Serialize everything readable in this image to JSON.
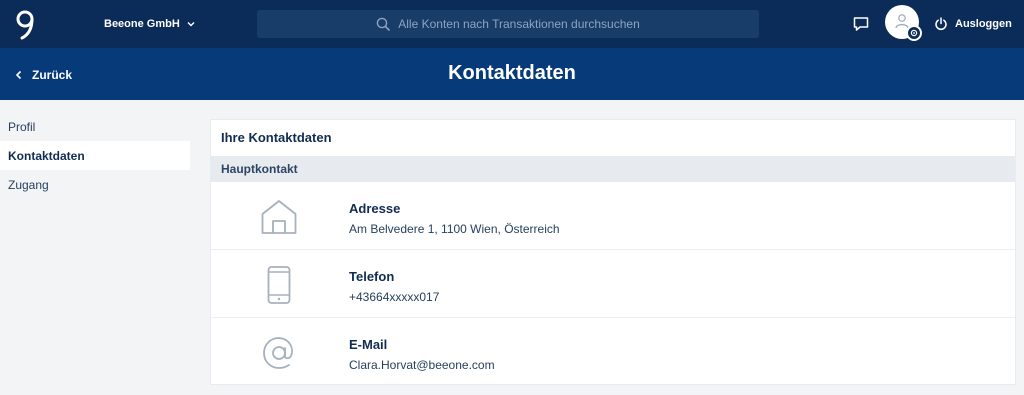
{
  "header": {
    "company": "Beeone GmbH",
    "search_placeholder": "Alle Konten nach Transaktionen durchsuchen",
    "logout_label": "Ausloggen"
  },
  "subheader": {
    "back_label": "Zurück",
    "title": "Kontaktdaten"
  },
  "sidebar": {
    "items": [
      {
        "label": "Profil",
        "active": false
      },
      {
        "label": "Kontaktdaten",
        "active": true
      },
      {
        "label": "Zugang",
        "active": false
      }
    ]
  },
  "card": {
    "title": "Ihre Kontaktdaten",
    "section": "Hauptkontakt",
    "rows": [
      {
        "icon": "house-icon",
        "label": "Adresse",
        "value": "Am Belvedere 1, 1100 Wien, Österreich"
      },
      {
        "icon": "phone-icon",
        "label": "Telefon",
        "value": "+43664xxxxx017"
      },
      {
        "icon": "at-sign-icon",
        "label": "E-Mail",
        "value": "Clara.Horvat@beeone.com"
      }
    ]
  },
  "colors": {
    "topbar": "#0b2c58",
    "subheader": "#073a78",
    "background": "#f3f4f6",
    "text_primary": "#112c52"
  }
}
